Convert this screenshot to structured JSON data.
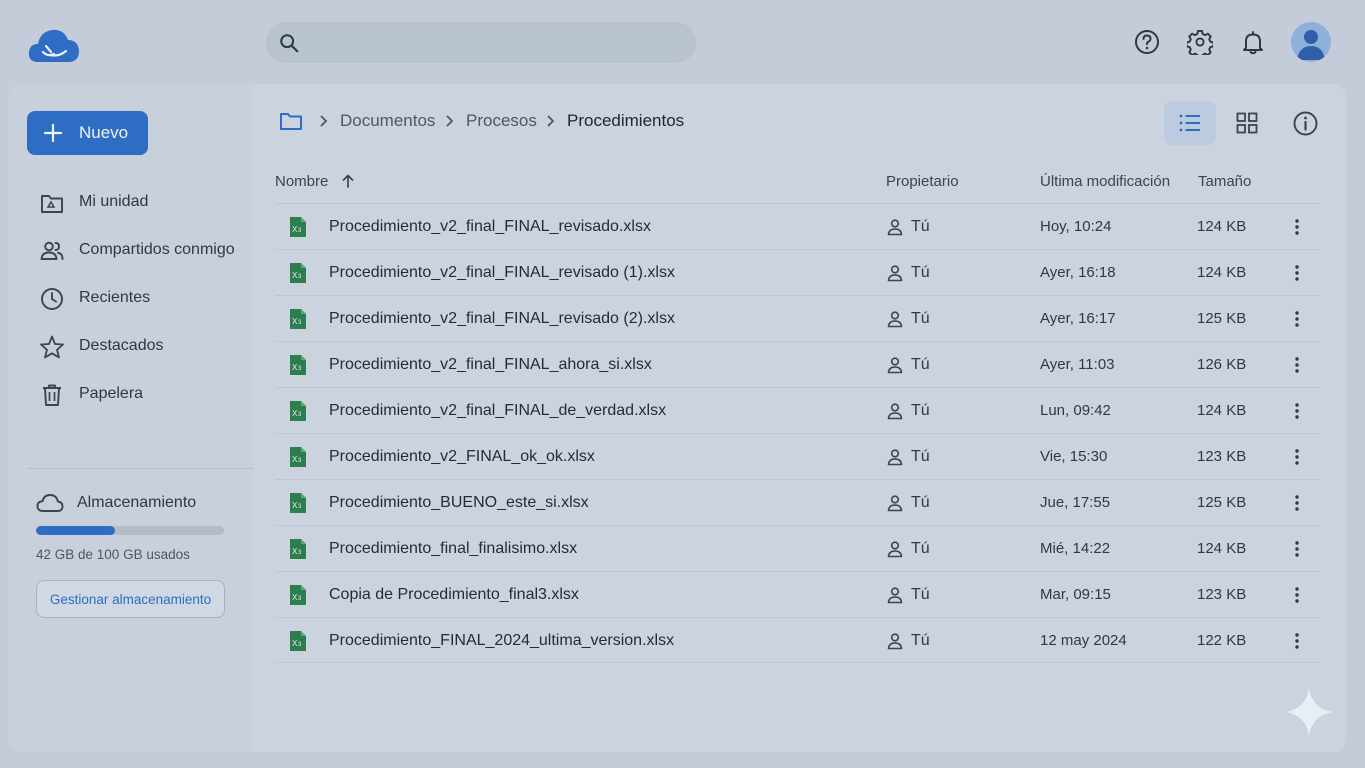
{
  "header": {
    "search": {
      "value": "",
      "placeholder": ""
    }
  },
  "sidebar": {
    "new_button": "Nuevo",
    "items": [
      {
        "label": "Mi unidad",
        "icon": "my-drive-icon"
      },
      {
        "label": "Compartidos conmigo",
        "icon": "shared-people-icon"
      },
      {
        "label": "Recientes",
        "icon": "clock-icon"
      },
      {
        "label": "Destacados",
        "icon": "star-icon"
      },
      {
        "label": "Papelera",
        "icon": "trash-icon"
      }
    ],
    "storage": {
      "title": "Almacenamiento",
      "used_text": "42 GB de 100 GB usados",
      "used_fraction": 0.42,
      "manage_button": "Gestionar almacenamiento"
    }
  },
  "breadcrumb": {
    "items": [
      "Documentos",
      "Procesos",
      "Procedimientos"
    ]
  },
  "table": {
    "headers": {
      "name": "Nombre",
      "owner": "Propietario",
      "modified": "Última modificación",
      "size": "Tamaño"
    },
    "sort": "ascending",
    "rows": [
      {
        "name": "Procedimiento_v2_final_FINAL_revisado.xlsx",
        "owner": "Tú",
        "modified": "Hoy, 10:24",
        "size": "124 KB"
      },
      {
        "name": "Procedimiento_v2_final_FINAL_revisado (1).xlsx",
        "owner": "Tú",
        "modified": "Ayer, 16:18",
        "size": "124 KB"
      },
      {
        "name": "Procedimiento_v2_final_FINAL_revisado (2).xlsx",
        "owner": "Tú",
        "modified": "Ayer, 16:17",
        "size": "125 KB"
      },
      {
        "name": "Procedimiento_v2_final_FINAL_ahora_si.xlsx",
        "owner": "Tú",
        "modified": "Ayer, 11:03",
        "size": "126 KB"
      },
      {
        "name": "Procedimiento_v2_final_FINAL_de_verdad.xlsx",
        "owner": "Tú",
        "modified": "Lun, 09:42",
        "size": "124 KB"
      },
      {
        "name": "Procedimiento_v2_FINAL_ok_ok.xlsx",
        "owner": "Tú",
        "modified": "Vie, 15:30",
        "size": "123 KB"
      },
      {
        "name": "Procedimiento_BUENO_este_si.xlsx",
        "owner": "Tú",
        "modified": "Jue, 17:55",
        "size": "125 KB"
      },
      {
        "name": "Procedimiento_final_finalisimo.xlsx",
        "owner": "Tú",
        "modified": "Mié, 14:22",
        "size": "124 KB"
      },
      {
        "name": "Copia de Procedimiento_final3.xlsx",
        "owner": "Tú",
        "modified": "Mar, 09:15",
        "size": "123 KB"
      },
      {
        "name": "Procedimiento_FINAL_2024_ultima_version.xlsx",
        "owner": "Tú",
        "modified": "12 may 2024",
        "size": "122 KB"
      }
    ]
  },
  "colors": {
    "accent": "#2f6cc3",
    "background": "#c3ccd8",
    "excel_green": "#2e7d4f"
  },
  "icons": [
    "app-logo-icon",
    "search-icon",
    "help-icon",
    "settings-icon",
    "notifications-icon",
    "avatar",
    "folder-icon",
    "list-view-icon",
    "grid-view-icon",
    "info-icon",
    "excel-file-icon",
    "person-icon",
    "more-vert-icon",
    "sparkle-icon"
  ]
}
